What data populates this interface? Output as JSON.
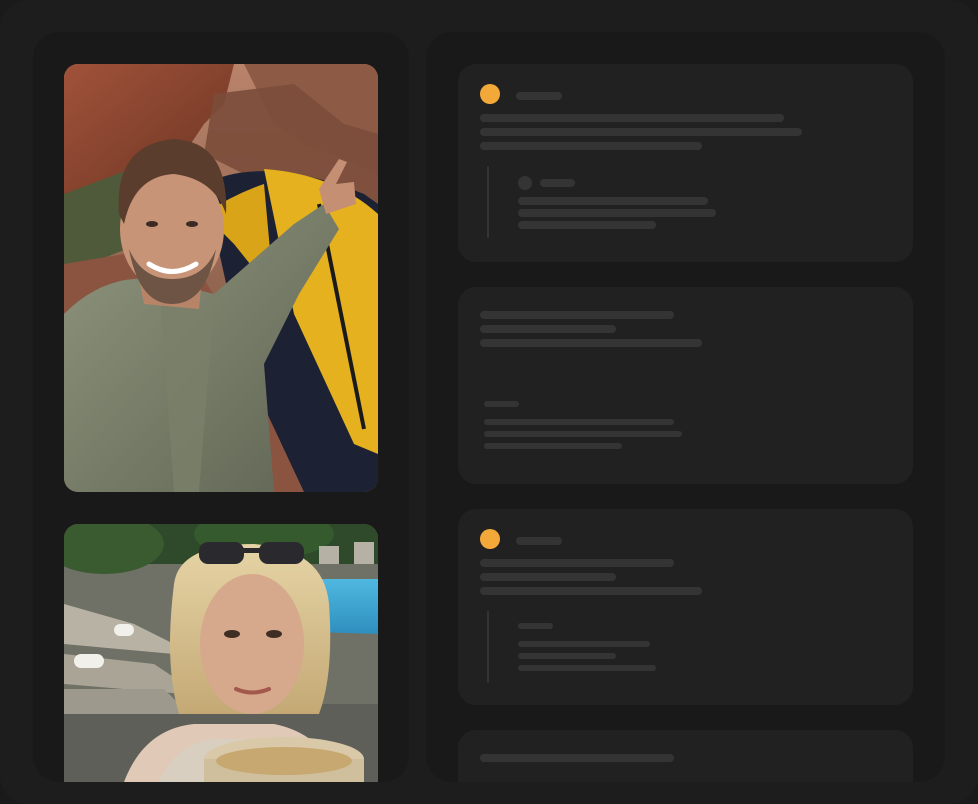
{
  "theme": {
    "accent": "#f2a93a",
    "background": "#1e1d1e",
    "panel": "#1a191a",
    "card": "#222122",
    "skeleton": "#353435"
  },
  "photos": [
    {
      "name": "photo-hiker-selfie-with-tent",
      "icon": "image-icon"
    },
    {
      "name": "photo-woman-selfie-by-pool",
      "icon": "image-icon"
    }
  ],
  "feed": {
    "cards": [
      {
        "avatar_color": "#f2a93a",
        "text": "",
        "reply": {
          "text": ""
        }
      },
      {
        "text": "",
        "reply": {
          "text": ""
        }
      },
      {
        "avatar_color": "#f2a93a",
        "text": "",
        "reply": {
          "text": ""
        }
      },
      {
        "text": ""
      }
    ]
  }
}
